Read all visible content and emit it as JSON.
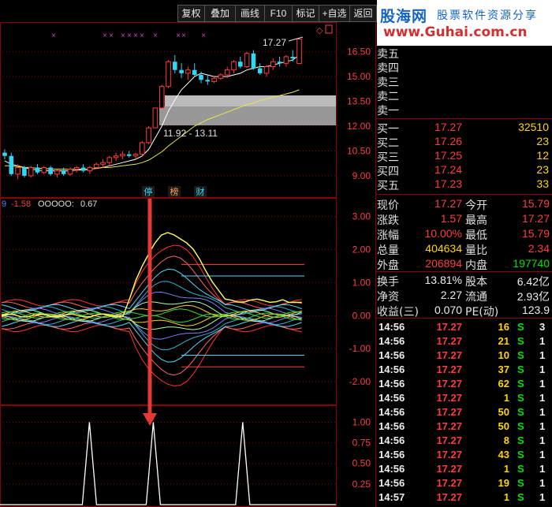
{
  "toolbar": [
    {
      "label": "复权"
    },
    {
      "label": "叠加"
    },
    {
      "label": "画线"
    },
    {
      "label": "F10"
    },
    {
      "label": "标记"
    },
    {
      "label": "+自选"
    },
    {
      "label": "返回"
    }
  ],
  "watermark": {
    "logo": "股海网",
    "slogan": "股票软件资源分享",
    "url": "www.Guhai.com.cn"
  },
  "price_axis": [
    "16.50",
    "15.00",
    "13.50",
    "12.00",
    "10.50",
    "9.00"
  ],
  "annotations": {
    "high": "17.27",
    "range": "11.92 - 13.11"
  },
  "event_markers": [
    {
      "label": "停",
      "color": "#31d7f2"
    },
    {
      "label": "榜",
      "color": "#ffa040"
    },
    {
      "label": "财",
      "color": "#31d7f2"
    }
  ],
  "indicator_header": {
    "prefix": "9",
    "value1": "-1.58",
    "name": "OOOOO:",
    "value2": "0.67"
  },
  "indicator_axis": [
    "3.00",
    "2.00",
    "1.00",
    "0.00",
    "-1.00",
    "-2.00"
  ],
  "signal_axis": [
    "1.00",
    "0.75",
    "0.50",
    "0.25"
  ],
  "order_book": {
    "asks": [
      {
        "label": "卖五"
      },
      {
        "label": "卖四"
      },
      {
        "label": "卖三"
      },
      {
        "label": "卖二"
      },
      {
        "label": "卖一"
      }
    ],
    "bids": [
      {
        "label": "买一",
        "price": "17.27",
        "vol": "32510"
      },
      {
        "label": "买二",
        "price": "17.26",
        "vol": "23"
      },
      {
        "label": "买三",
        "price": "17.25",
        "vol": "12"
      },
      {
        "label": "买四",
        "price": "17.24",
        "vol": "23"
      },
      {
        "label": "买五",
        "price": "17.23",
        "vol": "33"
      }
    ]
  },
  "quote": [
    {
      "l1": "现价",
      "v1": "17.27",
      "c1": "red",
      "l2": "今开",
      "v2": "15.79",
      "c2": "red"
    },
    {
      "l1": "涨跌",
      "v1": "1.57",
      "c1": "red",
      "l2": "最高",
      "v2": "17.27",
      "c2": "red"
    },
    {
      "l1": "涨幅",
      "v1": "10.00%",
      "c1": "red",
      "l2": "最低",
      "v2": "15.79",
      "c2": "red"
    },
    {
      "l1": "总量",
      "v1": "404634",
      "c1": "yel",
      "l2": "量比",
      "v2": "2.34",
      "c2": "red"
    },
    {
      "l1": "外盘",
      "v1": "206894",
      "c1": "red",
      "l2": "内盘",
      "v2": "197740",
      "c2": "grn"
    },
    {
      "l1": "换手",
      "v1": "13.81%",
      "c1": "wht",
      "l2": "股本",
      "v2": "6.42亿",
      "c2": "wht"
    },
    {
      "l1": "净资",
      "v1": "2.27",
      "c1": "wht",
      "l2": "流通",
      "v2": "2.93亿",
      "c2": "wht"
    },
    {
      "l1": "收益(三)",
      "v1": "0.070",
      "c1": "wht",
      "l2": "PE(动)",
      "v2": "123.9",
      "c2": "wht"
    }
  ],
  "ticks": [
    {
      "time": "14:56",
      "price": "17.27",
      "vol": "16",
      "side": "S",
      "n": "3"
    },
    {
      "time": "14:56",
      "price": "17.27",
      "vol": "21",
      "side": "S",
      "n": "1"
    },
    {
      "time": "14:56",
      "price": "17.27",
      "vol": "10",
      "side": "S",
      "n": "1"
    },
    {
      "time": "14:56",
      "price": "17.27",
      "vol": "37",
      "side": "S",
      "n": "1"
    },
    {
      "time": "14:56",
      "price": "17.27",
      "vol": "62",
      "side": "S",
      "n": "1"
    },
    {
      "time": "14:56",
      "price": "17.27",
      "vol": "1",
      "side": "S",
      "n": "1"
    },
    {
      "time": "14:56",
      "price": "17.27",
      "vol": "50",
      "side": "S",
      "n": "1"
    },
    {
      "time": "14:56",
      "price": "17.27",
      "vol": "50",
      "side": "S",
      "n": "1"
    },
    {
      "time": "14:56",
      "price": "17.27",
      "vol": "8",
      "side": "S",
      "n": "1"
    },
    {
      "time": "14:56",
      "price": "17.27",
      "vol": "43",
      "side": "S",
      "n": "1"
    },
    {
      "time": "14:56",
      "price": "17.27",
      "vol": "1",
      "side": "S",
      "n": "1"
    },
    {
      "time": "14:56",
      "price": "17.27",
      "vol": "19",
      "side": "S",
      "n": "1"
    },
    {
      "time": "14:57",
      "price": "17.27",
      "vol": "1",
      "side": "S",
      "n": "1"
    }
  ],
  "colors": {
    "up": "#ff3c3c",
    "down": "#31d7f2",
    "ma_fast": "#ffffff",
    "ma_slow": "#e6e64a",
    "grid": "#8b0000",
    "signal_arrow": "#e53935"
  },
  "chart_data": [
    {
      "type": "candlestick",
      "ylim": [
        7.9,
        18.2
      ],
      "ticks": [
        "16.50",
        "15.00",
        "13.50",
        "12.00",
        "10.50",
        "9.00"
      ],
      "candles": [
        [
          10.4,
          10.6,
          10.0,
          10.2
        ],
        [
          10.2,
          10.4,
          9.0,
          9.1
        ],
        [
          9.1,
          9.7,
          8.8,
          9.5
        ],
        [
          9.5,
          9.6,
          8.9,
          9.0
        ],
        [
          9.0,
          9.6,
          8.9,
          9.5
        ],
        [
          9.5,
          9.7,
          9.1,
          9.2
        ],
        [
          9.2,
          9.6,
          9.1,
          9.5
        ],
        [
          9.5,
          9.6,
          9.0,
          9.1
        ],
        [
          9.1,
          9.4,
          8.9,
          9.3
        ],
        [
          9.3,
          9.5,
          9.0,
          9.1
        ],
        [
          9.1,
          9.5,
          9.0,
          9.4
        ],
        [
          9.4,
          9.6,
          9.2,
          9.5
        ],
        [
          9.5,
          9.7,
          9.2,
          9.3
        ],
        [
          9.3,
          9.6,
          9.1,
          9.5
        ],
        [
          9.5,
          9.8,
          9.4,
          9.7
        ],
        [
          9.7,
          10.0,
          9.5,
          9.8
        ],
        [
          9.8,
          10.2,
          9.6,
          10.1
        ],
        [
          10.1,
          10.4,
          9.9,
          10.2
        ],
        [
          10.2,
          10.5,
          10.0,
          10.3
        ],
        [
          10.3,
          10.5,
          10.1,
          10.2
        ],
        [
          10.2,
          10.4,
          10.0,
          10.3
        ],
        [
          10.3,
          11.1,
          10.2,
          11.0
        ],
        [
          11.0,
          12.0,
          10.9,
          11.9
        ],
        [
          11.9,
          13.1,
          11.9,
          13.1
        ],
        [
          13.1,
          14.5,
          13.1,
          14.4
        ],
        [
          14.4,
          16.0,
          14.3,
          15.9
        ],
        [
          15.9,
          16.3,
          15.2,
          15.4
        ],
        [
          15.4,
          15.8,
          14.9,
          15.2
        ],
        [
          15.2,
          15.6,
          14.8,
          15.4
        ],
        [
          15.4,
          15.8,
          15.0,
          15.1
        ],
        [
          15.1,
          15.3,
          14.6,
          14.8
        ],
        [
          14.8,
          15.1,
          14.5,
          14.7
        ],
        [
          14.7,
          15.0,
          14.6,
          14.9
        ],
        [
          14.9,
          15.2,
          14.8,
          15.1
        ],
        [
          15.1,
          15.6,
          14.9,
          15.4
        ],
        [
          15.4,
          16.0,
          15.2,
          15.9
        ],
        [
          15.9,
          16.2,
          15.5,
          15.6
        ],
        [
          15.6,
          16.5,
          15.5,
          16.4
        ],
        [
          16.4,
          16.6,
          15.4,
          15.5
        ],
        [
          15.5,
          15.8,
          15.1,
          15.2
        ],
        [
          15.2,
          15.7,
          15.0,
          15.6
        ],
        [
          15.6,
          16.1,
          15.4,
          15.9
        ],
        [
          15.9,
          16.2,
          15.6,
          15.8
        ],
        [
          15.8,
          16.3,
          15.6,
          16.2
        ],
        [
          16.2,
          16.6,
          15.9,
          16.1
        ],
        [
          15.79,
          17.27,
          15.79,
          17.27
        ]
      ],
      "ma_fast": [
        9.9,
        9.7,
        9.6,
        9.5,
        9.4,
        9.35,
        9.3,
        9.3,
        9.3,
        9.3,
        9.3,
        9.35,
        9.35,
        9.4,
        9.45,
        9.5,
        9.6,
        9.7,
        9.8,
        9.9,
        10.0,
        10.2,
        10.6,
        11.3,
        12.0,
        12.9,
        13.6,
        14.2,
        14.6,
        15.0,
        15.2,
        15.1,
        15.0,
        15.0,
        15.0,
        15.1,
        15.2,
        15.4,
        15.5,
        15.6,
        15.6,
        15.7,
        15.8,
        15.9,
        16.0,
        16.3
      ],
      "ma_slow": [
        9.6,
        9.6,
        9.55,
        9.5,
        9.5,
        9.45,
        9.45,
        9.4,
        9.4,
        9.4,
        9.4,
        9.4,
        9.4,
        9.4,
        9.45,
        9.5,
        9.5,
        9.55,
        9.6,
        9.65,
        9.7,
        9.8,
        9.95,
        10.2,
        10.45,
        10.8,
        11.1,
        11.4,
        11.7,
        12.0,
        12.2,
        12.4,
        12.55,
        12.7,
        12.85,
        13.0,
        13.15,
        13.3,
        13.4,
        13.55,
        13.65,
        13.75,
        13.85,
        13.95,
        14.05,
        14.2
      ]
    },
    {
      "type": "line",
      "ylim": [
        -2.5,
        3.3
      ],
      "ticks": [
        "3.00",
        "2.00",
        "1.00",
        "0.00",
        "-1.00",
        "-2.00"
      ],
      "header": "OOOOO: 0.67"
    },
    {
      "type": "line",
      "ylim": [
        0,
        1.1
      ],
      "ticks": [
        "1.00",
        "0.75",
        "0.50",
        "0.25"
      ],
      "spikes_at": [
        14,
        24,
        38
      ]
    }
  ]
}
